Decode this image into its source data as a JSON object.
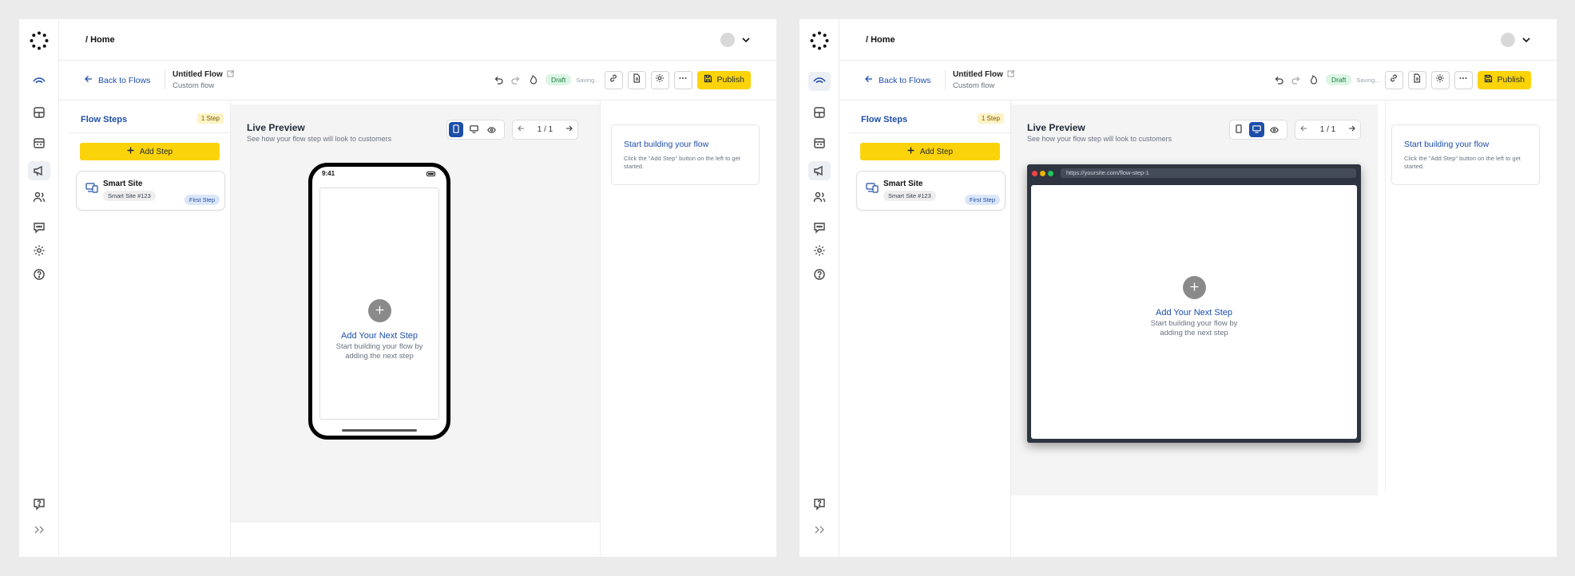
{
  "screens": [
    {
      "breadcrumb": "/ Home",
      "back_label": "Back to Flows",
      "flow_title": "Untitled Flow",
      "flow_subtitle": "Custom flow",
      "status": "Draft",
      "saving": "Saving...",
      "publish_label": "Publish",
      "steps_title": "Flow Steps",
      "steps_count": "1 Step",
      "add_step_label": "Add Step",
      "step_name": "Smart Site",
      "step_chip": "Smart Site #123",
      "step_badge": "First Step",
      "preview_title": "Live Preview",
      "preview_subtitle": "See how your flow step will look to customers",
      "page_indicator": "1 / 1",
      "device_selected": "mobile",
      "phone_time": "9:41",
      "empty_title": "Add Your Next Step",
      "empty_subtitle": "Start building your flow by adding the next step",
      "help_title": "Start building your flow",
      "help_text": "Click the \"Add Step\" button on the left to get started."
    },
    {
      "breadcrumb": "/ Home",
      "back_label": "Back to Flows",
      "flow_title": "Untitled Flow",
      "flow_subtitle": "Custom flow",
      "status": "Draft",
      "saving": "Saving...",
      "publish_label": "Publish",
      "steps_title": "Flow Steps",
      "steps_count": "1 Step",
      "add_step_label": "Add Step",
      "step_name": "Smart Site",
      "step_chip": "Smart Site #123",
      "step_badge": "First Step",
      "preview_title": "Live Preview",
      "preview_subtitle": "See how your flow step will look to customers",
      "page_indicator": "1 / 1",
      "device_selected": "desktop",
      "browser_url": "https://yoursite.com/flow-step-1",
      "empty_title": "Add Your Next Step",
      "empty_subtitle": "Start building your flow by adding the next step",
      "help_title": "Start building your flow",
      "help_text": "Click the \"Add Step\" button on the left to get started."
    }
  ],
  "icons": {
    "rail": [
      "logo-icon",
      "eye-icon",
      "layout-icon",
      "calendar-icon",
      "megaphone-icon",
      "users-icon",
      "chat-icon",
      "settings-icon",
      "help-icon",
      "support-icon",
      "expand-icon"
    ],
    "toolbar": [
      "undo-icon",
      "redo-icon",
      "fire-icon",
      "link-icon",
      "document-icon",
      "settings-icon",
      "more-icon",
      "save-icon"
    ]
  },
  "colors": {
    "accent_yellow": "#fbd30a",
    "link_blue": "#1d4ea8",
    "draft_green": "#15803d"
  }
}
